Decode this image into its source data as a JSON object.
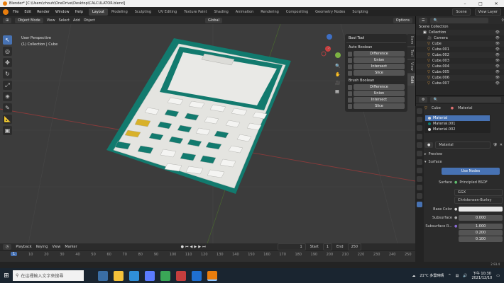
{
  "window": {
    "title": "Blender* [C:\\Users\\chouh\\OneDrive\\Desktop\\CALCULATOR.blend]"
  },
  "menu": [
    "File",
    "Edit",
    "Render",
    "Window",
    "Help"
  ],
  "workspaces": [
    "Layout",
    "Modeling",
    "Sculpting",
    "UV Editing",
    "Texture Paint",
    "Shading",
    "Animation",
    "Rendering",
    "Compositing",
    "Geometry Nodes",
    "Scripting"
  ],
  "scene": {
    "name": "Scene",
    "view_layer": "View Layer"
  },
  "viewport_header": {
    "mode": "Object Mode",
    "menus": [
      "View",
      "Select",
      "Add",
      "Object"
    ],
    "orientation": "Global",
    "options": "Options"
  },
  "viewport": {
    "line1": "User Perspective",
    "line2": "(1) Collection | Cube"
  },
  "bool_tool": {
    "title": "Bool Tool",
    "auto_title": "Auto Boolean",
    "auto_buttons": [
      "Difference",
      "Union",
      "Intersect",
      "Slice"
    ],
    "brush_title": "Brush Boolean",
    "brush_buttons": [
      "Difference",
      "Union",
      "Intersect",
      "Slice"
    ]
  },
  "side_tabs": [
    "Item",
    "Tool",
    "View",
    "Edit"
  ],
  "timeline": {
    "menus": [
      "Playback",
      "Keying",
      "View",
      "Marker"
    ],
    "current": "1",
    "start_label": "Start",
    "start": "1",
    "end_label": "End",
    "end": "250",
    "ticks": [
      "1",
      "10",
      "20",
      "30",
      "40",
      "50",
      "60",
      "70",
      "80",
      "90",
      "100",
      "110",
      "120",
      "130",
      "140",
      "150",
      "160",
      "170",
      "180",
      "190",
      "200",
      "210",
      "220",
      "230",
      "240",
      "250"
    ]
  },
  "outliner": {
    "root": "Scene Collection",
    "items": [
      "Collection",
      "Camera",
      "Cube",
      "Cube.001",
      "Cube.002",
      "Cube.003",
      "Cube.004",
      "Cube.005",
      "Cube.006",
      "Cube.007"
    ]
  },
  "properties": {
    "object": "Cube",
    "material_tab": "Material",
    "slots": [
      "Material",
      "Material.001",
      "Material.002"
    ],
    "material_name": "Material",
    "preview": "Preview",
    "surface_section": "Surface",
    "use_nodes": "Use Nodes",
    "surface_label": "Surface",
    "surface_value": "Principled BSDF",
    "dist1": "GGX",
    "dist2": "Christensen-Burley",
    "base_color": "Base Color",
    "subsurface": "Subsurface",
    "subsurface_value": "0.000",
    "subsurface_r": "Subsurface R...",
    "sr_values": [
      "1.000",
      "0.200",
      "0.100"
    ],
    "version": "2.93.4"
  },
  "taskbar": {
    "search": "在這裡輸入文字來搜尋",
    "weather": "21°C 多雲時晴",
    "time": "下午 10:30",
    "date": "2021/12/10"
  },
  "colors": {
    "accent": "#4772b3",
    "calc_teal": "#127a6e",
    "calc_body": "#e6e6e2",
    "calc_yellow": "#d8b12a",
    "orange": "#e87d0d"
  }
}
